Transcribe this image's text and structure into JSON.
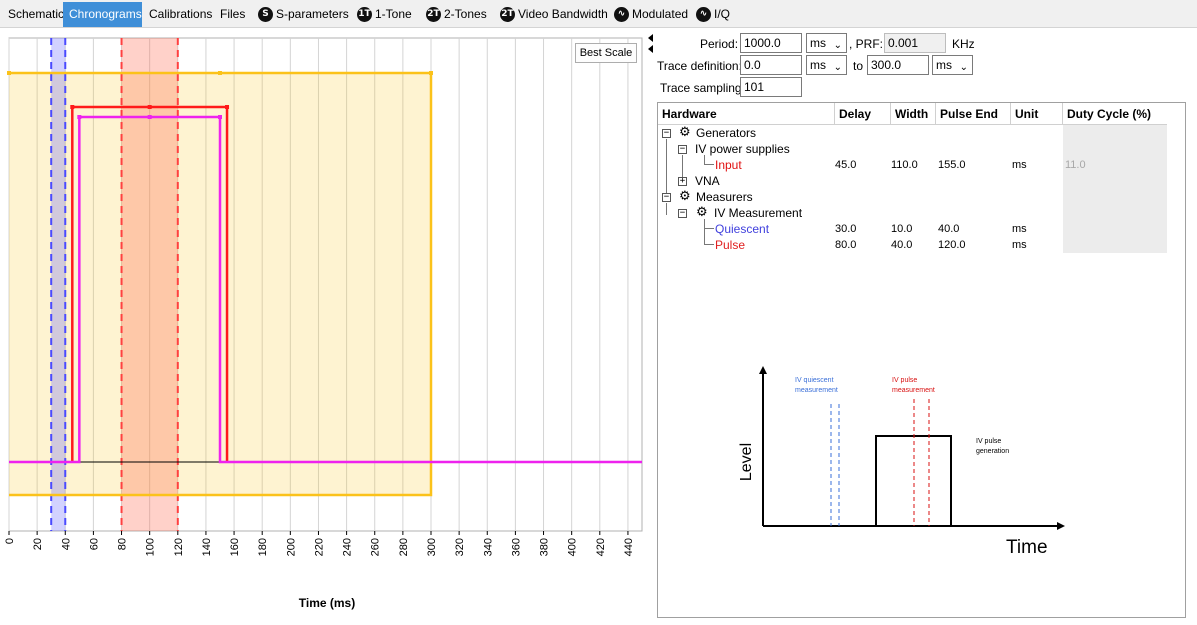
{
  "tabs": [
    {
      "label": "Schematic",
      "icon": "",
      "active": false
    },
    {
      "label": "Chronograms",
      "icon": "",
      "active": true
    },
    {
      "label": "Calibrations",
      "icon": "",
      "active": false
    },
    {
      "label": "Files",
      "icon": "",
      "active": false
    },
    {
      "label": "S-parameters",
      "icon": "S",
      "active": false
    },
    {
      "label": "1-Tone",
      "icon": "1T",
      "active": false
    },
    {
      "label": "2-Tones",
      "icon": "2T",
      "active": false
    },
    {
      "label": "Video Bandwidth",
      "icon": "2T",
      "active": false
    },
    {
      "label": "Modulated",
      "icon": "waveform-icon",
      "active": false
    },
    {
      "label": "I/Q",
      "icon": "waveform-icon",
      "active": false
    }
  ],
  "chart": {
    "best_scale_label": "Best Scale",
    "xaxis_title": "Time (ms)"
  },
  "chart_data": {
    "type": "line",
    "xlabel": "Time (ms)",
    "xlim": [
      0,
      450
    ],
    "xticks": [
      0,
      20,
      40,
      60,
      80,
      100,
      120,
      140,
      160,
      180,
      200,
      220,
      240,
      260,
      280,
      300,
      320,
      340,
      360,
      380,
      400,
      420,
      440
    ],
    "window": {
      "start": 0.0,
      "end": 300.0,
      "color": "#fbc21a"
    },
    "series": [
      {
        "name": "Input",
        "color": "#ff1a1a",
        "start": 45.0,
        "end": 155.0
      },
      {
        "name": "Pulse",
        "color": "#ee22ee",
        "start": 50.0,
        "end": 150.0
      }
    ],
    "bands": [
      {
        "name": "Quiescent",
        "start": 30.0,
        "end": 40.0,
        "color": "#4a4aff"
      },
      {
        "name": "Pulse",
        "start": 80.0,
        "end": 120.0,
        "color": "#ff4040"
      }
    ]
  },
  "form": {
    "period_label": "Period:",
    "period_value": "1000.0",
    "period_unit": "ms",
    "prf_label": ", PRF:",
    "prf_value": "0.001",
    "prf_unit": "KHz",
    "trace_def_label": "Trace definition:",
    "trace_from": "0.0",
    "trace_from_unit": "ms",
    "to_label": "to",
    "trace_to": "300.0",
    "trace_to_unit": "ms",
    "trace_sampling_label": "Trace sampling:",
    "trace_sampling_value": "101"
  },
  "tree": {
    "columns": [
      "Hardware",
      "Delay",
      "Width",
      "Pulse End",
      "Unit",
      "Duty Cycle (%)"
    ],
    "rows": [
      {
        "label": "Generators",
        "delay": "",
        "width": "",
        "end": "",
        "unit": "",
        "duty": "",
        "color": "#000000"
      },
      {
        "label": "IV power supplies",
        "delay": "",
        "width": "",
        "end": "",
        "unit": "",
        "duty": "",
        "color": "#000000"
      },
      {
        "label": "Input",
        "delay": "45.0",
        "width": "110.0",
        "end": "155.0",
        "unit": "ms",
        "duty": "11.0",
        "color": "#e01010"
      },
      {
        "label": "VNA",
        "delay": "",
        "width": "",
        "end": "",
        "unit": "",
        "duty": "",
        "color": "#000000"
      },
      {
        "label": "Measurers",
        "delay": "",
        "width": "",
        "end": "",
        "unit": "",
        "duty": "",
        "color": "#000000"
      },
      {
        "label": "IV Measurement",
        "delay": "",
        "width": "",
        "end": "",
        "unit": "",
        "duty": "",
        "color": "#000000"
      },
      {
        "label": "Quiescent",
        "delay": "30.0",
        "width": "10.0",
        "end": "40.0",
        "unit": "ms",
        "duty": "",
        "color": "#4040dd"
      },
      {
        "label": "Pulse",
        "delay": "80.0",
        "width": "40.0",
        "end": "120.0",
        "unit": "ms",
        "duty": "",
        "color": "#e02020"
      }
    ]
  },
  "diagram": {
    "ylabel": "Level",
    "xlabel": "Time",
    "quiescent_label_1": "IV quiescent",
    "quiescent_label_2": "measurement",
    "pulse_meas_label_1": "IV pulse",
    "pulse_meas_label_2": "measurement",
    "pulse_gen_label_1": "IV pulse",
    "pulse_gen_label_2": "generation"
  }
}
